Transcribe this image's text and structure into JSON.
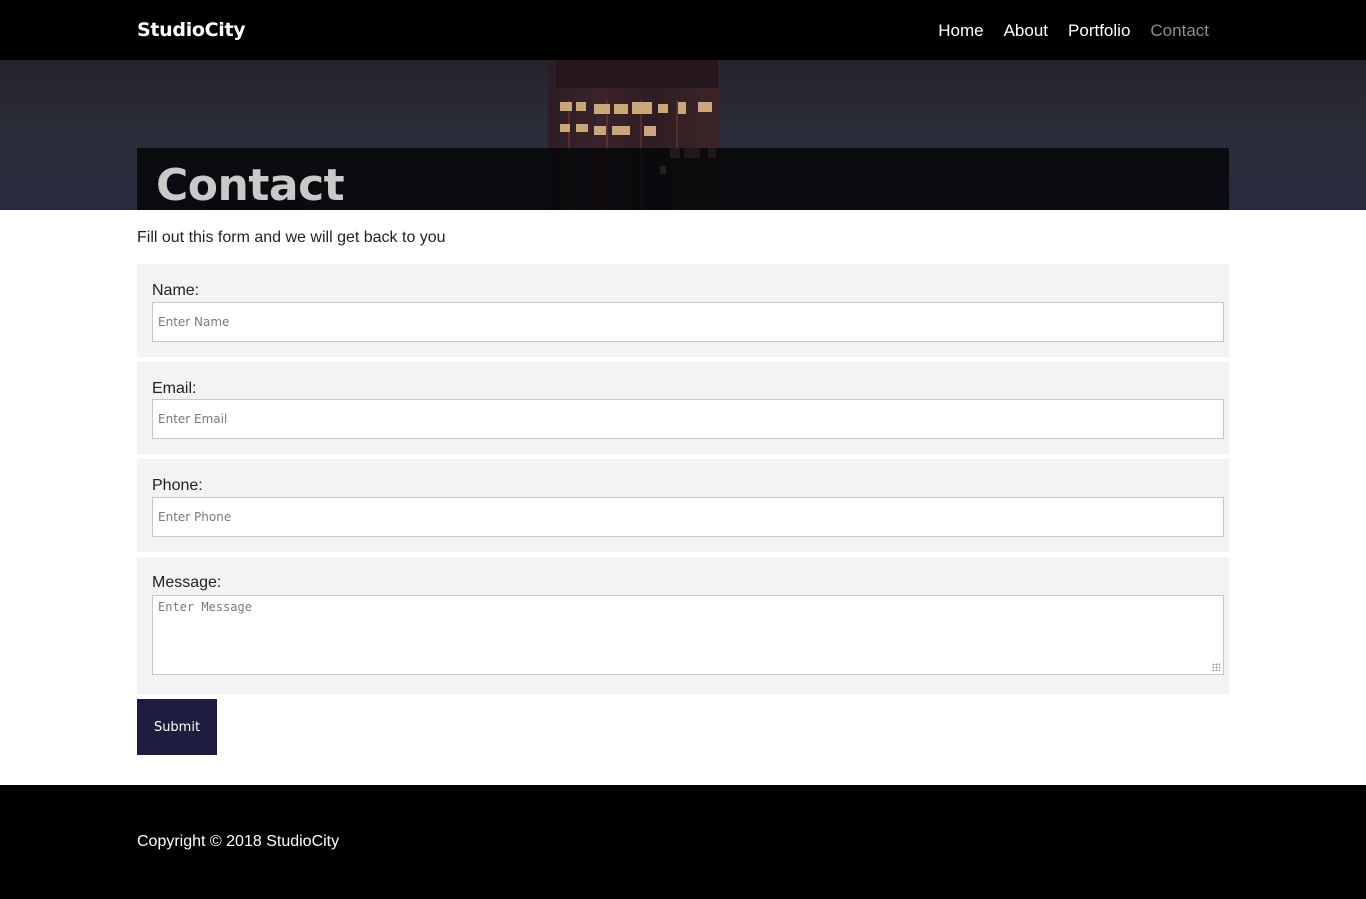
{
  "header": {
    "brand": "StudioCity",
    "nav": [
      {
        "label": "Home",
        "active": false
      },
      {
        "label": "About",
        "active": false
      },
      {
        "label": "Portfolio",
        "active": false
      },
      {
        "label": "Contact",
        "active": true
      }
    ]
  },
  "hero": {
    "title": "Contact"
  },
  "main": {
    "intro": "Fill out this form and we will get back to you",
    "form": {
      "name": {
        "label": "Name:",
        "placeholder": "Enter Name",
        "value": ""
      },
      "email": {
        "label": "Email:",
        "placeholder": "Enter Email",
        "value": ""
      },
      "phone": {
        "label": "Phone:",
        "placeholder": "Enter Phone",
        "value": ""
      },
      "message": {
        "label": "Message:",
        "placeholder": "Enter Message",
        "value": ""
      },
      "submit_label": "Submit"
    }
  },
  "footer": {
    "copyright": "Copyright © 2018 StudioCity"
  },
  "colors": {
    "navbar": "#000000",
    "active_nav": "#8f8f8f",
    "form_group_bg": "#f3f3f3",
    "submit_bg": "#1e1d3f",
    "footer": "#000000"
  }
}
